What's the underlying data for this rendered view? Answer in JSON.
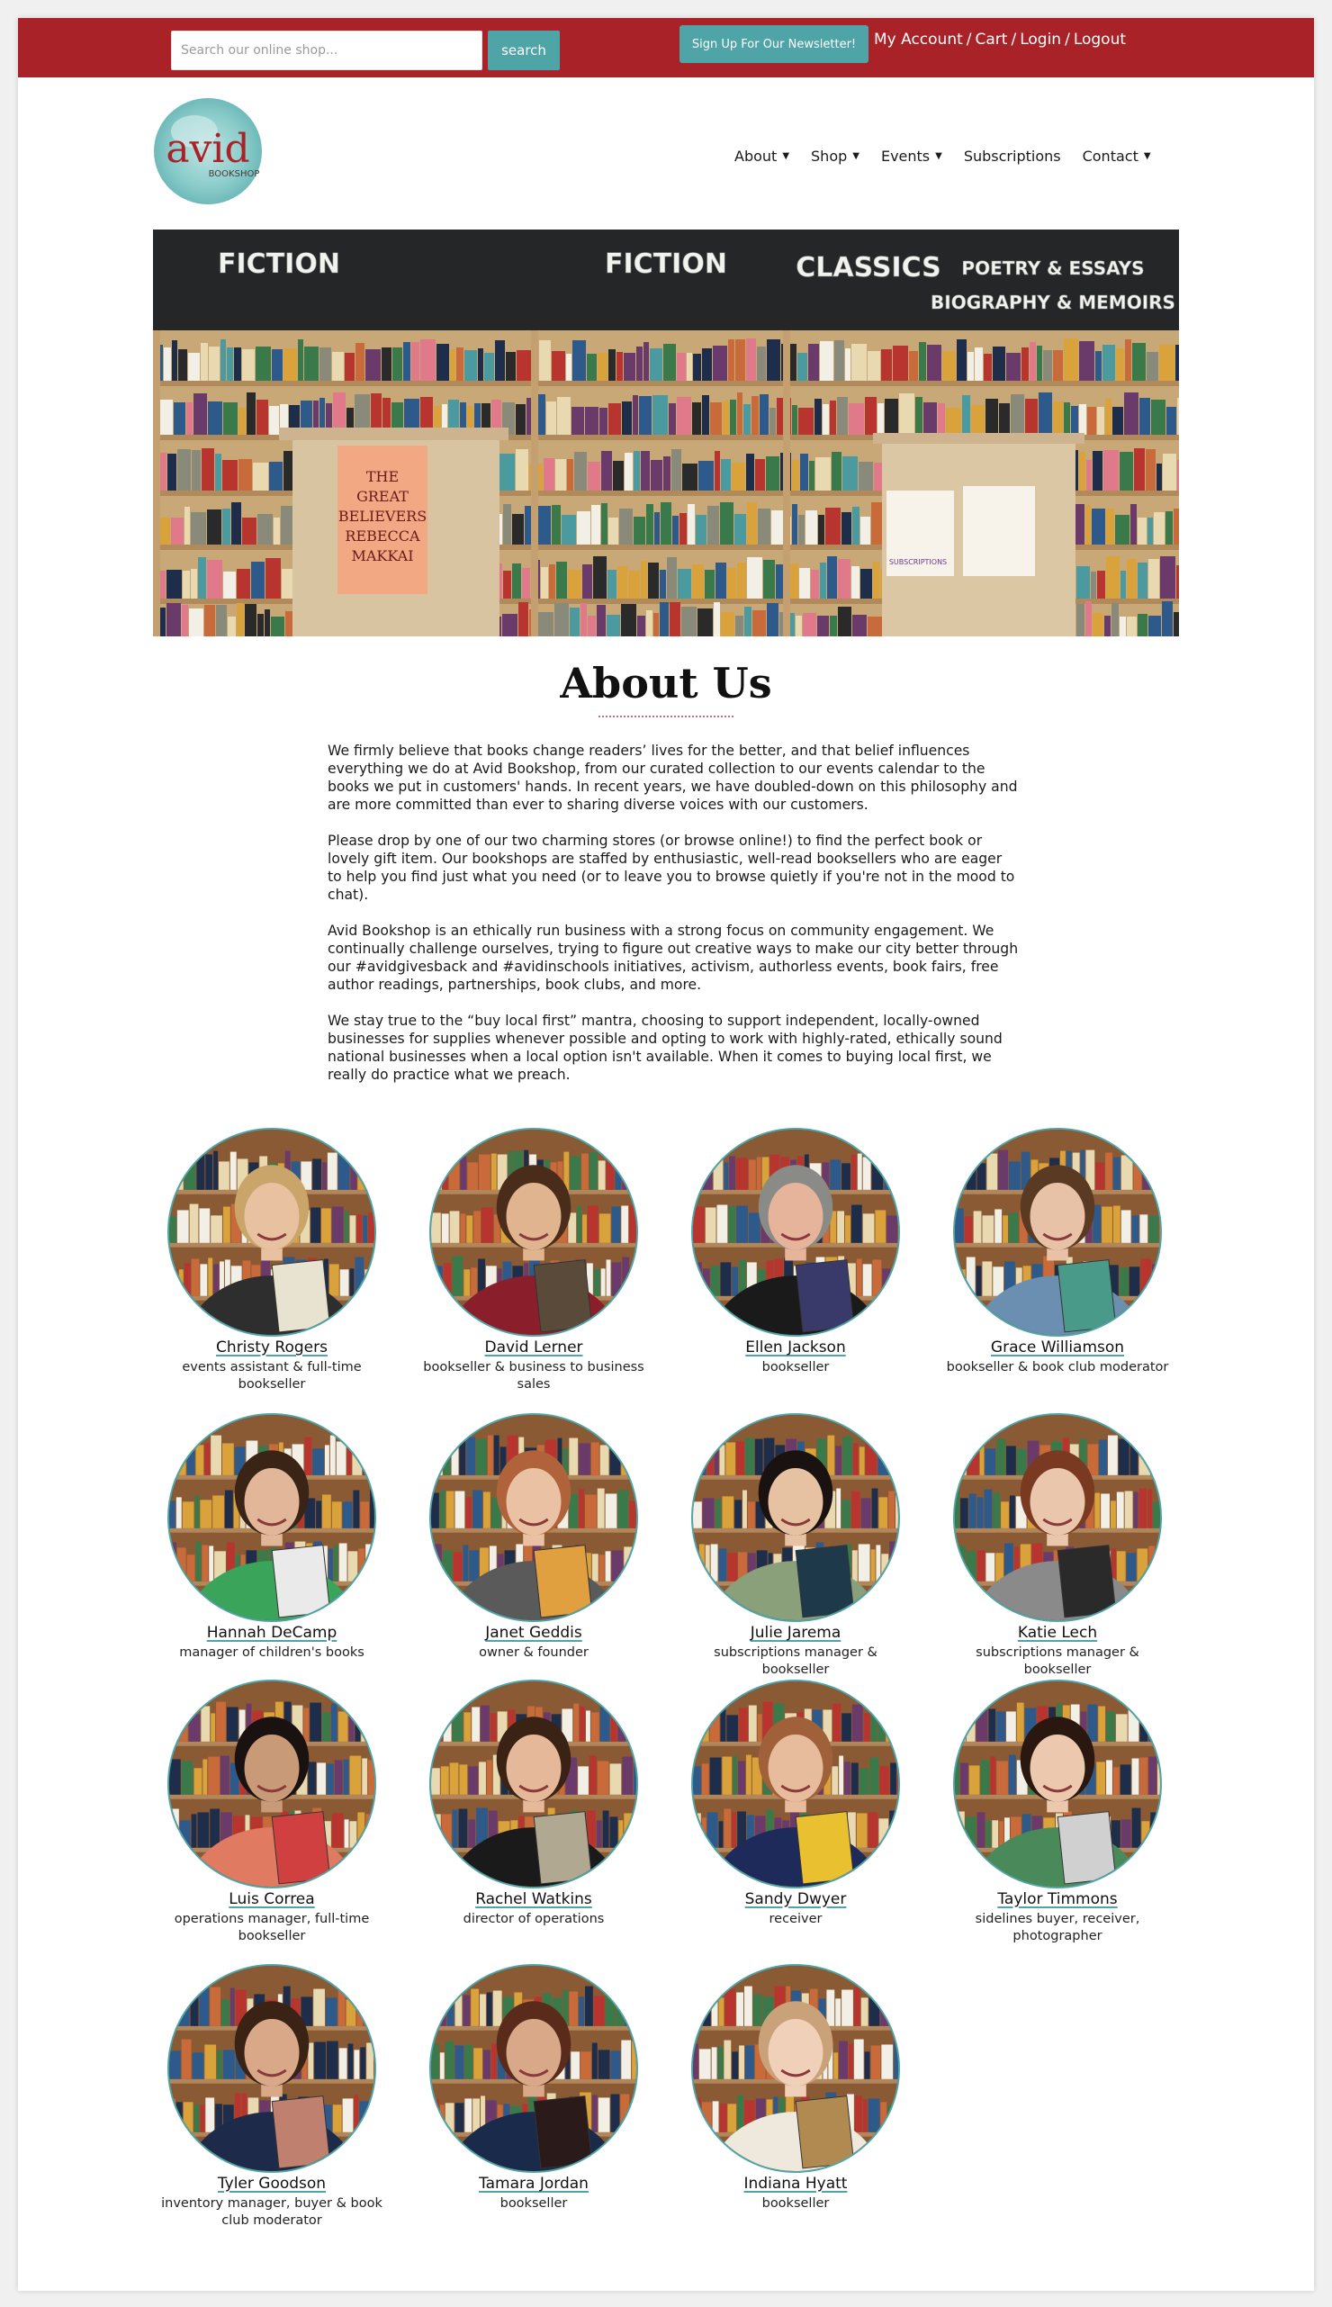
{
  "topbar": {
    "search_placeholder": "Search our online shop...",
    "search_button": "search",
    "newsletter_button": "Sign Up For Our Newsletter!",
    "links": [
      "My Account",
      "Cart",
      "Login",
      "Logout"
    ]
  },
  "logo": {
    "word": "avid",
    "sub": "BOOKSHOP"
  },
  "nav": [
    "About",
    "Shop",
    "Events",
    "Subscriptions",
    "Contact"
  ],
  "hero": {
    "signs": [
      "FICTION",
      "FICTION",
      "CLASSICS",
      "POETRY & ESSAYS",
      "BIOGRAPHY & MEMOIRS"
    ],
    "book": [
      "THE",
      "GREAT",
      "BELIEVERS",
      "REBECCA",
      "MAKKAI"
    ],
    "stand_label": "SUBSCRIPTIONS"
  },
  "about": {
    "title": "About Us",
    "paragraphs": [
      "We firmly believe that books change readers’ lives for the better, and that belief influences everything we do at Avid Bookshop, from our curated collection to our events calendar to the books we put in customers' hands. In recent years, we have doubled-down on this philosophy and are more committed than ever to sharing diverse voices with our customers.",
      "Please drop by one of our two charming stores (or browse online!) to find the perfect book or lovely gift item. Our bookshops are staffed by enthusiastic, well-read booksellers who are eager to help you find just what you need (or to leave you to browse quietly if you're not in the mood to chat).",
      "Avid Bookshop is an ethically run business with a strong focus on community engagement. We continually challenge ourselves, trying to figure out creative ways to make our city better through our #avidgivesback and #avidinschools initiatives, activism, authorless events, book fairs, free author readings, partnerships, book clubs, and more.",
      "We stay true to the “buy local first” mantra, choosing to support independent, locally-owned businesses for supplies whenever possible and opting to work with highly-rated, ethically sound national businesses when a local option isn't available. When it comes to buying local first, we really do practice what we preach."
    ]
  },
  "staff": [
    {
      "name": "Christy Rogers",
      "role": "events assistant & full-time bookseller",
      "shirt": "#2e2e2e",
      "hair": "#c9a56a",
      "skin": "#e8c2a0",
      "book": "#e8e2d0"
    },
    {
      "name": "David Lerner",
      "role": "bookseller & business to business sales",
      "shirt": "#8a1f2b",
      "hair": "#4a2c1a",
      "skin": "#e0b48f",
      "book": "#5a4a3a"
    },
    {
      "name": "Ellen Jackson",
      "role": "bookseller",
      "shirt": "#1a1a1a",
      "hair": "#8a8a86",
      "skin": "#e6b49a",
      "book": "#3a3a6a"
    },
    {
      "name": "Grace Williamson",
      "role": "bookseller & book club moderator",
      "shirt": "#6a8fb0",
      "hair": "#5a3a22",
      "skin": "#e7c2a6",
      "book": "#4a9a8a"
    },
    {
      "name": "Hannah DeCamp",
      "role": "manager of children's books",
      "shirt": "#3aa55a",
      "hair": "#3a2416",
      "skin": "#e2b698",
      "book": "#eaeaea"
    },
    {
      "name": "Janet Geddis",
      "role": "owner & founder",
      "shirt": "#5a5a5a",
      "hair": "#b0623a",
      "skin": "#eac1a2",
      "book": "#e0a040"
    },
    {
      "name": "Julie Jarema",
      "role": "subscriptions manager & bookseller",
      "shirt": "#8aa07a",
      "hair": "#1a1210",
      "skin": "#e6c2a2",
      "book": "#1e3a4a"
    },
    {
      "name": "Katie Lech",
      "role": "subscriptions manager & bookseller",
      "shirt": "#8a8a8a",
      "hair": "#7a3a22",
      "skin": "#eac6ac",
      "book": "#2a2a2a"
    },
    {
      "name": "Luis Correa",
      "role": "operations manager, full-time bookseller",
      "shirt": "#e07a60",
      "hair": "#1a1210",
      "skin": "#c99a78",
      "book": "#d04040"
    },
    {
      "name": "Rachel Watkins",
      "role": "director of operations",
      "shirt": "#1a1a1a",
      "hair": "#3a2214",
      "skin": "#e4b898",
      "book": "#b0a890"
    },
    {
      "name": "Sandy Dwyer",
      "role": "receiver",
      "shirt": "#1e2a5a",
      "hair": "#a0603a",
      "skin": "#e6bc9c",
      "book": "#e8c030"
    },
    {
      "name": "Taylor Timmons",
      "role": "sidelines buyer, receiver, photographer",
      "shirt": "#4a8a5a",
      "hair": "#2a1810",
      "skin": "#ecc8ae",
      "book": "#d0d0d0"
    },
    {
      "name": "Tyler Goodson",
      "role": "inventory manager, buyer & book club moderator",
      "shirt": "#1e2a4a",
      "hair": "#3a2214",
      "skin": "#d8a888",
      "book": "#c08070"
    },
    {
      "name": "Tamara Jordan",
      "role": "bookseller",
      "shirt": "#1a2a4a",
      "hair": "#5a2a1a",
      "skin": "#d8a888",
      "book": "#2a1a1a"
    },
    {
      "name": "Indiana Hyatt",
      "role": "bookseller",
      "shirt": "#efe8dc",
      "hair": "#c9a27a",
      "skin": "#f0d0b8",
      "book": "#b08a50"
    }
  ],
  "colors": {
    "brand_red": "#a82227",
    "teal": "#4fa4a7"
  }
}
